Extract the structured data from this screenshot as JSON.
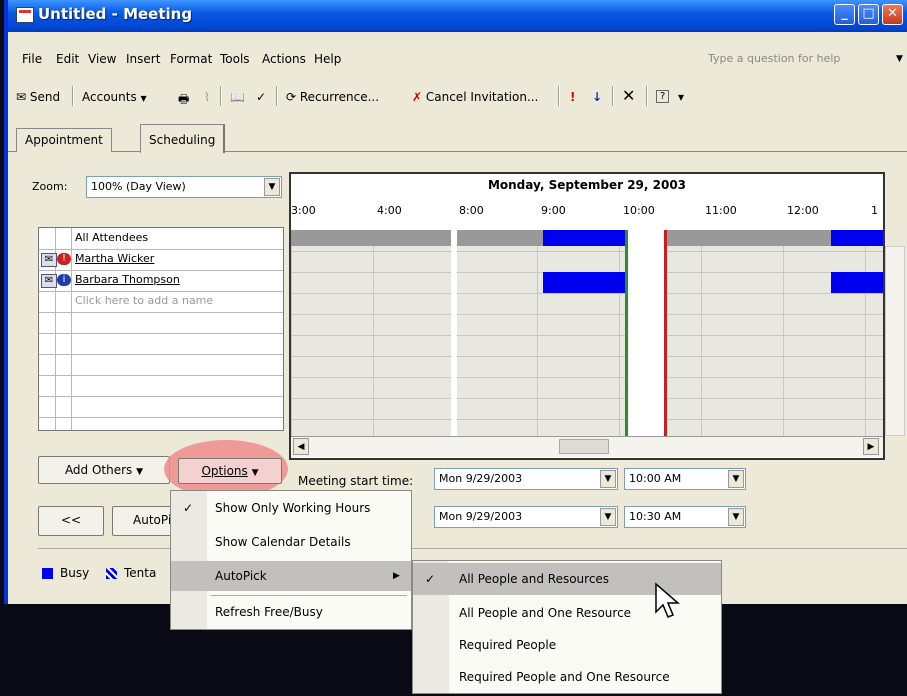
{
  "window": {
    "title": "Untitled - Meeting"
  },
  "title_buttons": {
    "minimize": "_",
    "maximize": "□",
    "close": "✕"
  },
  "menu": [
    "File",
    "Edit",
    "View",
    "Insert",
    "Format",
    "Tools",
    "Actions",
    "Help"
  ],
  "help_placeholder": "Type a question for help",
  "toolbar": {
    "send": "Send",
    "accounts": "Accounts",
    "recurrence": "Recurrence...",
    "cancel_invitation": "Cancel Invitation..."
  },
  "tabs": [
    "Appointment",
    "Scheduling"
  ],
  "zoom": {
    "label": "Zoom:",
    "value": "100% (Day View)"
  },
  "schedule": {
    "date_header": "Monday, September 29, 2003",
    "times": [
      "3:00",
      "4:00",
      "8:00",
      "9:00",
      "10:00",
      "11:00",
      "12:00",
      "1"
    ]
  },
  "attendees": {
    "header": "All Attendees",
    "rows": [
      "Martha Wicker",
      "Barbara Thompson"
    ],
    "add_placeholder": "Click here to add a name"
  },
  "buttons": {
    "add_others": "Add Others",
    "options": "Options",
    "prev": "<<",
    "autopick": "AutoPi"
  },
  "meeting": {
    "start_label": "Meeting start time:",
    "start_date": "Mon 9/29/2003",
    "start_time": "10:00 AM",
    "end_date": "Mon 9/29/2003",
    "end_time": "10:30 AM"
  },
  "legend": {
    "busy": "Busy",
    "tentative": "Tenta"
  },
  "options_menu": [
    "Show Only Working Hours",
    "Show Calendar Details",
    "AutoPick",
    "Refresh Free/Busy"
  ],
  "autopick_menu": [
    "All People and Resources",
    "All People and One Resource",
    "Required People",
    "Required People and One Resource"
  ],
  "colors": {
    "busy": "#0000ee",
    "titlebar": "#0a5ae3",
    "start_line": "#2e8b2e",
    "end_line": "#c81e1e",
    "highlight": "#f08c8c"
  }
}
